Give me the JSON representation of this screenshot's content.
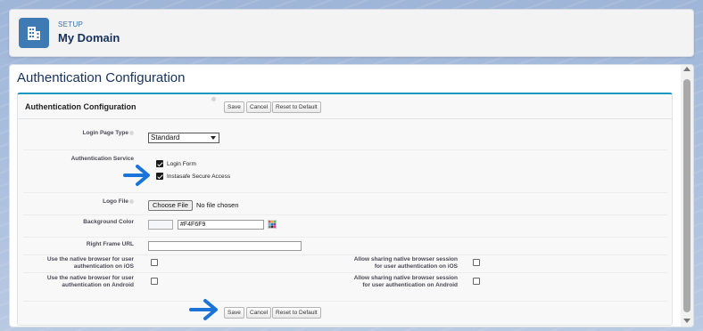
{
  "header": {
    "eyebrow": "SETUP",
    "title": "My Domain",
    "icon": "building-icon"
  },
  "page": {
    "title": "Authentication Configuration"
  },
  "block": {
    "title": "Authentication Configuration",
    "buttons": {
      "save": "Save",
      "cancel": "Cancel",
      "reset": "Reset to Default"
    }
  },
  "fields": {
    "login_page_type": {
      "label": "Login Page Type",
      "value": "Standard"
    },
    "auth_service": {
      "label": "Authentication Service",
      "options": [
        {
          "label": "Login Form",
          "checked": true
        },
        {
          "label": "Instasafe Secure Access",
          "checked": true
        }
      ]
    },
    "logo_file": {
      "label": "Logo File",
      "button": "Choose File",
      "status": "No file chosen"
    },
    "background_color": {
      "label": "Background Color",
      "value": "#F4F6F9"
    },
    "right_frame_url": {
      "label": "Right Frame URL",
      "value": ""
    },
    "native_browser_ios": {
      "label_line1": "Use the native browser for user",
      "label_line2": "authentication on iOS",
      "checked": false
    },
    "share_session_ios": {
      "label_line1": "Allow sharing native browser session",
      "label_line2": "for user authentication on iOS",
      "checked": false
    },
    "native_browser_android": {
      "label_line1": "Use the native browser for user",
      "label_line2": "authentication on Android",
      "checked": false
    },
    "share_session_android": {
      "label_line1": "Allow sharing native browser session",
      "label_line2": "for user authentication on Android",
      "checked": false
    }
  },
  "colors": {
    "accent": "#1797c0",
    "header_icon_bg": "#3e7ab3",
    "annotation_arrow": "#1a73d9",
    "swatch": "#f4f6f9"
  }
}
